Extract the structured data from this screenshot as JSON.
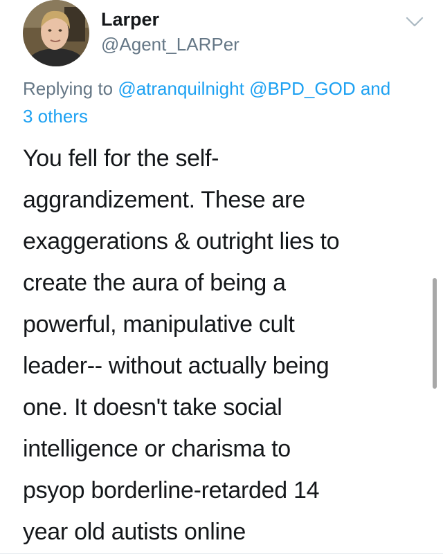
{
  "tweet": {
    "author": {
      "display_name": "Larper",
      "handle": "@Agent_LARPer",
      "avatar_icon": "user-avatar-photo"
    },
    "menu_icon": "chevron-down-icon",
    "reply": {
      "prefix": "Replying to ",
      "mention_1": "@atranquilnight",
      "mention_2": "@BPD_GOD",
      "joiner": " and",
      "others": "3 others"
    },
    "body_lines": [
      "You fell for the self-",
      "aggrandizement. These are",
      "exaggerations & outright lies to",
      "create the aura of being a",
      "powerful, manipulative cult",
      "leader-- without actually being",
      "one. It doesn't take social",
      "intelligence or charisma to",
      "psyop borderline-retarded 14",
      "year old autists online"
    ]
  },
  "colors": {
    "text": "#14171a",
    "secondary": "#657786",
    "link": "#1da1f2"
  }
}
